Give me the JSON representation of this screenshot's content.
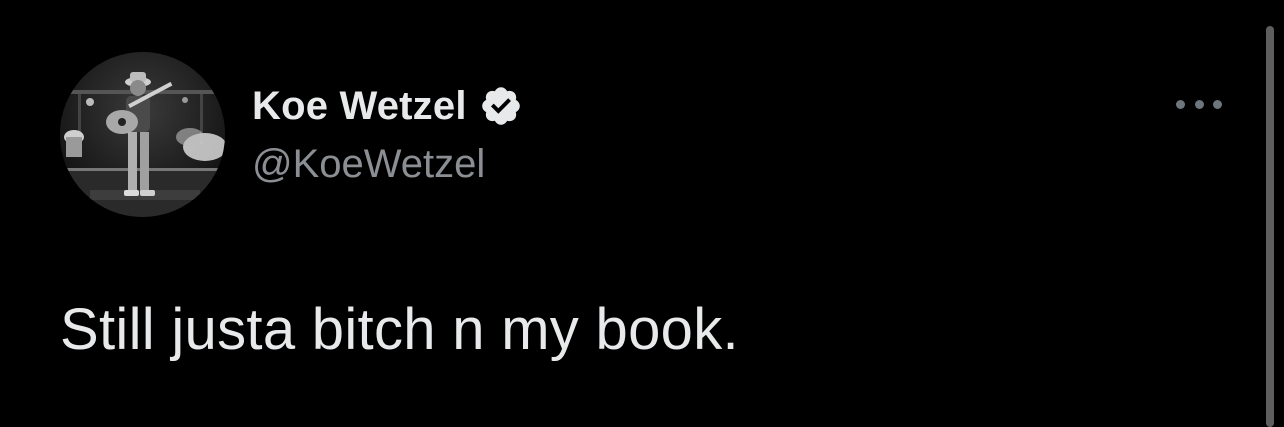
{
  "author": {
    "display_name": "Koe Wetzel",
    "handle": "@KoeWetzel",
    "verified": true,
    "avatar_icon": "performer-with-guitar-avatar"
  },
  "tweet": {
    "text": "Still justa bitch n my book."
  },
  "more_menu": {
    "icon": "more-horizontal-icon"
  },
  "colors": {
    "background": "#000000",
    "name": "#e7e9ea",
    "handle": "#8b8f94",
    "text": "#e7e9ea",
    "muted_icon": "#6e767d"
  }
}
